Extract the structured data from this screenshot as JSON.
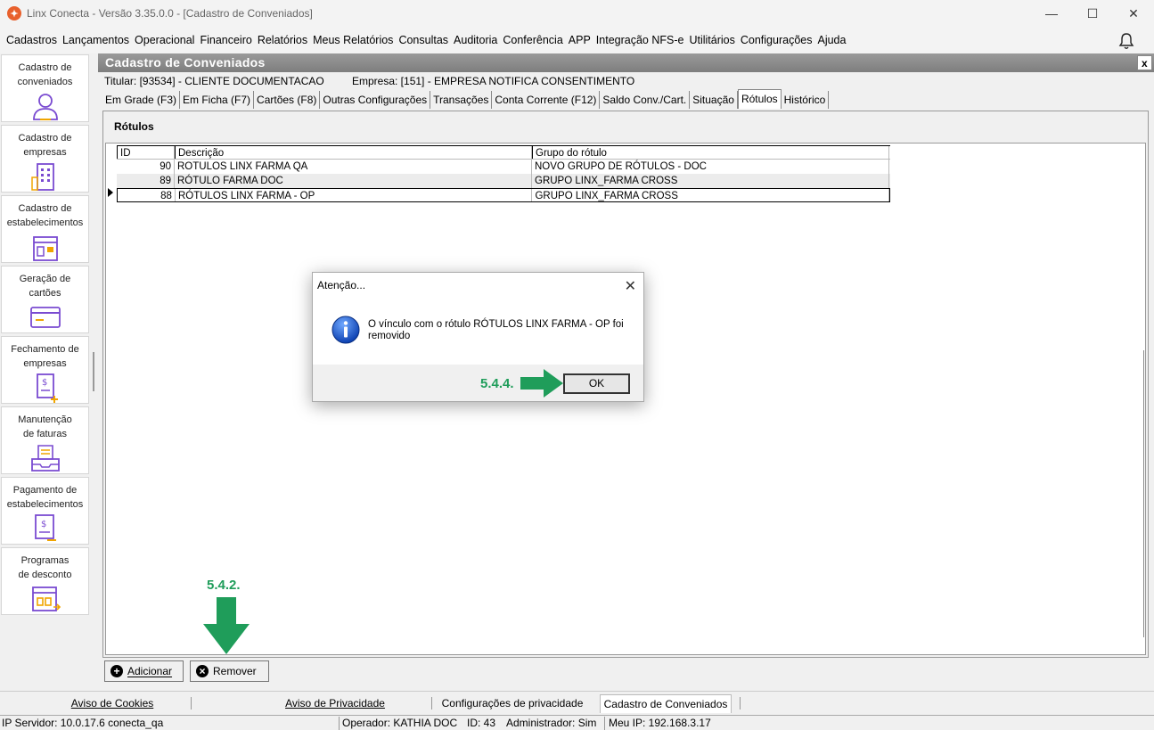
{
  "window": {
    "title": "Linx Conecta - Versão 3.35.0.0 - [Cadastro de Conveniados]",
    "minimize_glyph": "—",
    "maximize_glyph": "☐",
    "close_glyph": "✕"
  },
  "menu": [
    "Cadastros",
    "Lançamentos",
    "Operacional",
    "Financeiro",
    "Relatórios",
    "Meus Relatórios",
    "Consultas",
    "Auditoria",
    "Conferência",
    "APP",
    "Integração NFS-e",
    "Utilitários",
    "Configurações",
    "Ajuda"
  ],
  "sidebar": [
    {
      "label_1": "Cadastro de",
      "label_2": "conveniados",
      "icon": "user-icon"
    },
    {
      "label_1": "Cadastro de",
      "label_2": "empresas",
      "icon": "building-icon"
    },
    {
      "label_1": "Cadastro de",
      "label_2": "estabelecimentos",
      "icon": "store-icon"
    },
    {
      "label_1": "Geração de",
      "label_2": "cartões",
      "icon": "card-icon"
    },
    {
      "label_1": "Fechamento de",
      "label_2": "empresas",
      "icon": "invoice-icon"
    },
    {
      "label_1": "Manutenção",
      "label_2": "de faturas",
      "icon": "tray-icon"
    },
    {
      "label_1": "Pagamento de",
      "label_2": "estabelecimentos",
      "icon": "payment-icon"
    },
    {
      "label_1": "Programas",
      "label_2": "de desconto",
      "icon": "discount-icon"
    }
  ],
  "form": {
    "header": "Cadastro de Conveniados",
    "close": "x",
    "titular": "Titular: [93534] - CLIENTE DOCUMENTACAO",
    "empresa": "Empresa: [151] - EMPRESA NOTIFICA CONSENTIMENTO",
    "tabs": [
      "Em Grade (F3)",
      "Em Ficha (F7)",
      "Cartões (F8)",
      "Outras Configurações",
      "Transações",
      "Conta Corrente (F12)",
      "Saldo Conv./Cart.",
      "Situação",
      "Rótulos",
      "Histórico"
    ],
    "active_tab": "Rótulos",
    "panel_title": "Rótulos"
  },
  "grid": {
    "columns": [
      "ID",
      "Descrição",
      "Grupo do rótulo"
    ],
    "rows": [
      {
        "id": "90",
        "descricao": "ROTULOS LINX FARMA QA",
        "grupo": "NOVO GRUPO DE RÓTULOS - DOC"
      },
      {
        "id": "89",
        "descricao": "RÓTULO FARMA DOC",
        "grupo": "GRUPO LINX_FARMA CROSS"
      },
      {
        "id": "88",
        "descricao": "RÓTULOS LINX FARMA - OP",
        "grupo": "GRUPO LINX_FARMA CROSS"
      }
    ],
    "selected_row": 3
  },
  "buttons": {
    "add": "Adicionar",
    "remove": "Remover"
  },
  "dialog": {
    "title": "Atenção...",
    "close": "✕",
    "message": "O vínculo com o rótulo RÓTULOS LINX FARMA - OP foi removido",
    "ok": "OK"
  },
  "annotations": {
    "step_ok": "5.4.4.",
    "step_remove": "5.4.2.",
    "color": "#1f9d5a"
  },
  "footer_tabs": [
    "Aviso de Cookies",
    "Aviso de Privacidade",
    "Configurações de privacidade",
    "Cadastro de Conveniados"
  ],
  "status": {
    "server": "IP Servidor: 10.0.17.6 conecta_qa",
    "operator": "Operador: KATHIA DOC",
    "id": "ID: 43",
    "admin": "Administrador: Sim",
    "ip": "Meu IP: 192.168.3.17"
  },
  "colors": {
    "accent_orange": "#e8602c",
    "sidebar_icon": "#7a4bd1",
    "sidebar_icon_accent": "#f0a500",
    "header_gray": "#8a8a8a"
  }
}
